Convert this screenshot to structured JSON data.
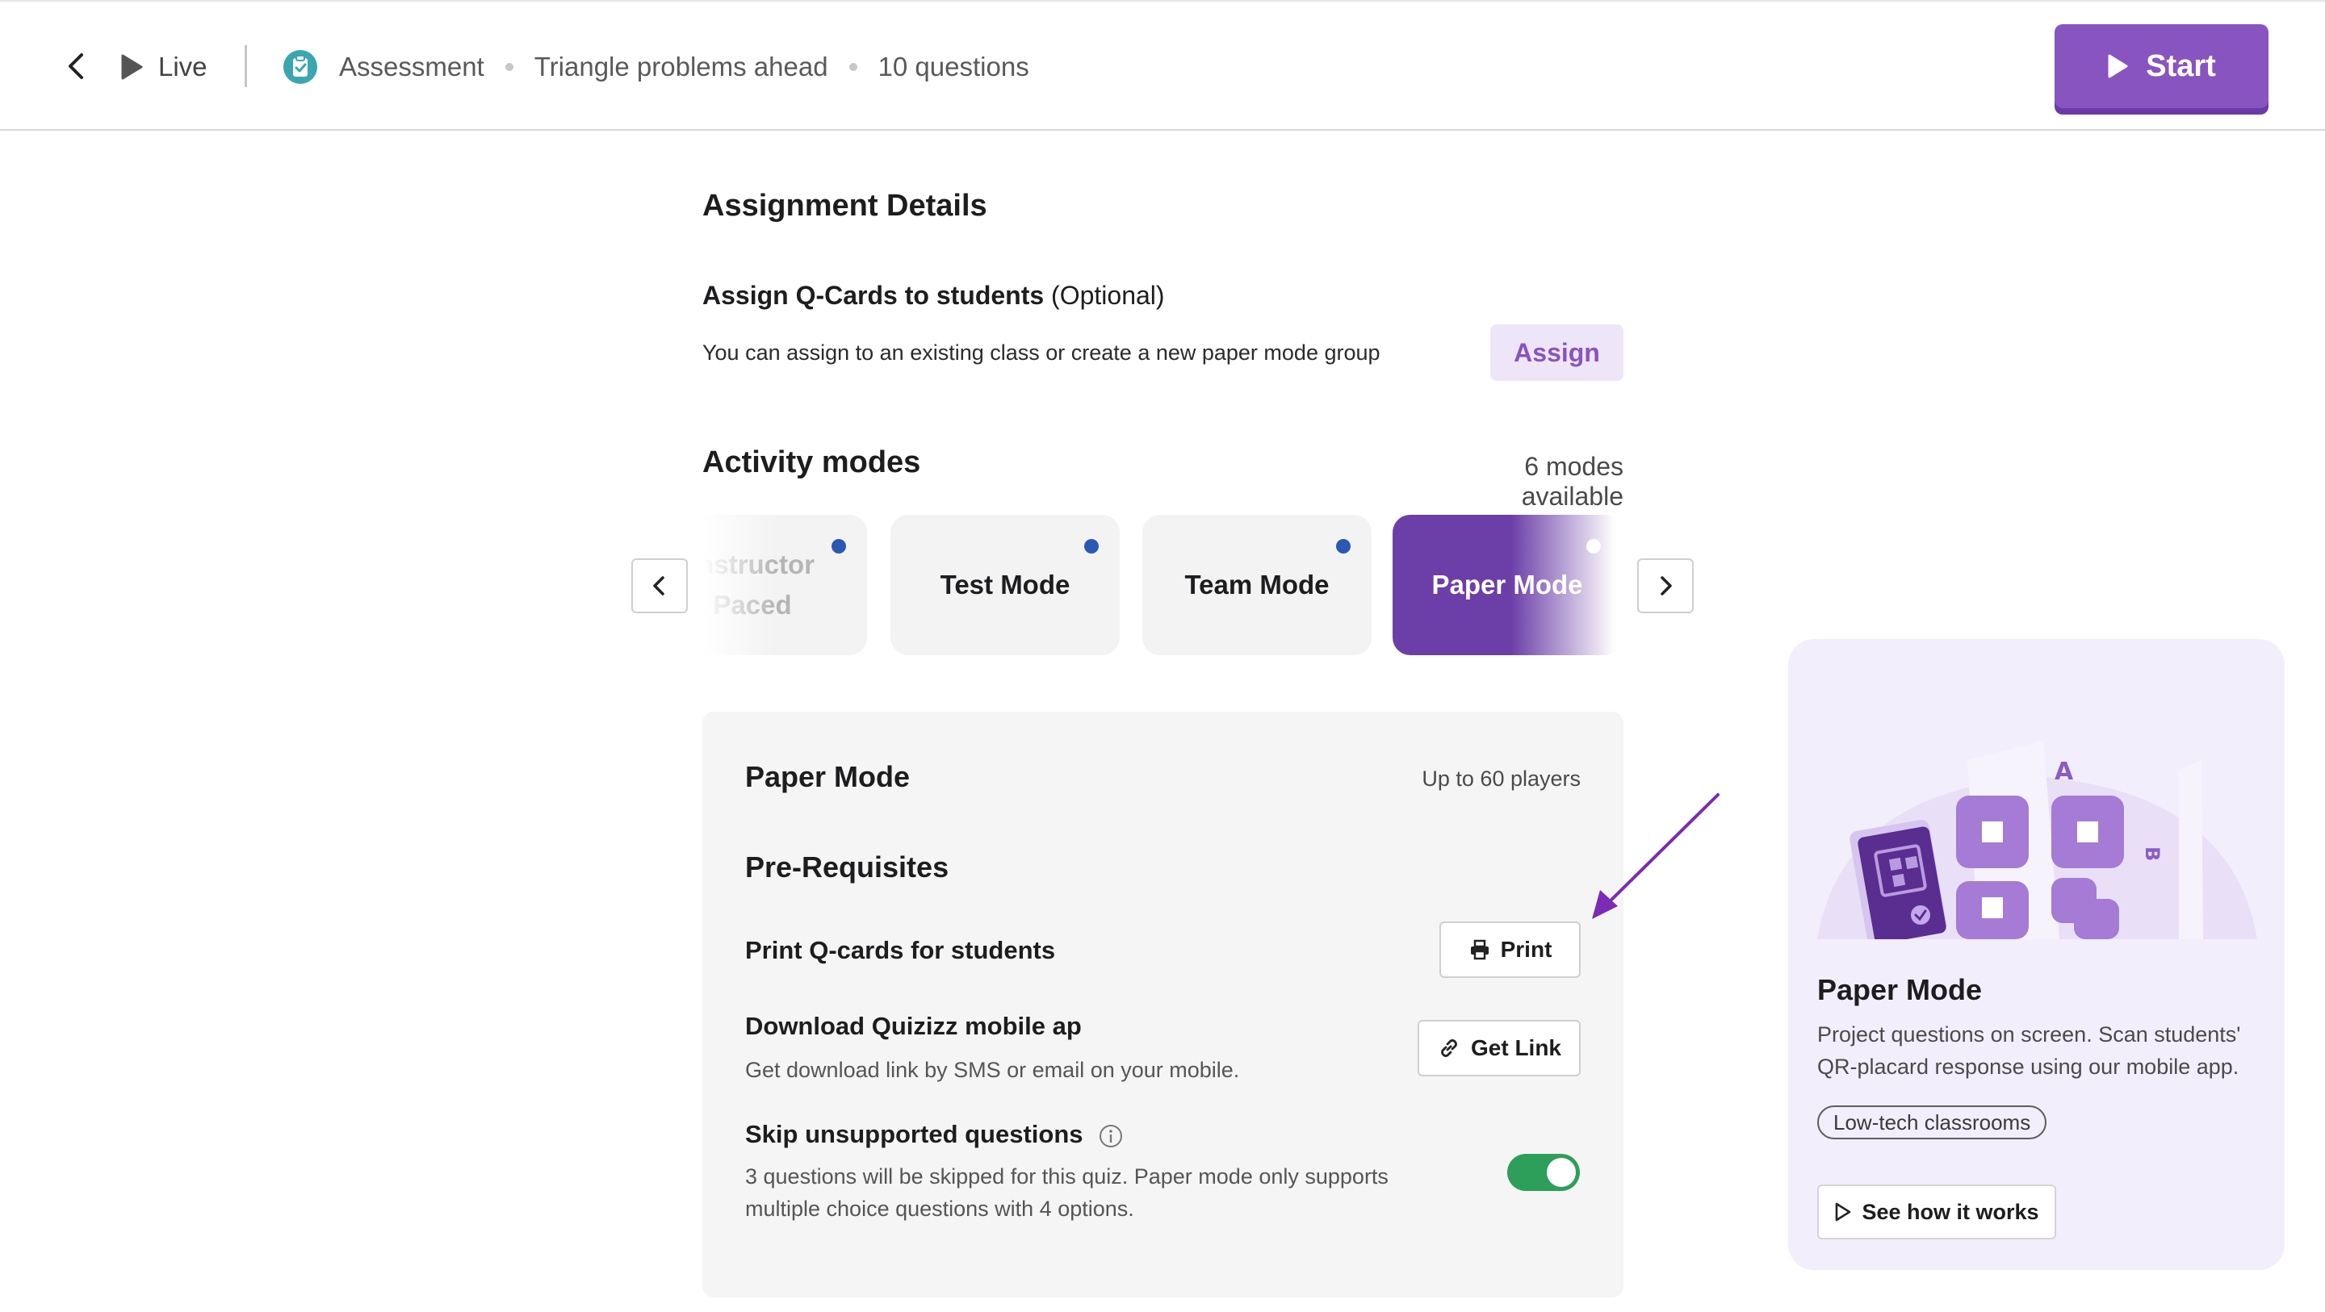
{
  "header": {
    "live_label": "Live",
    "breadcrumbs": [
      "Assessment",
      "Triangle problems ahead",
      "10 questions"
    ],
    "start_label": "Start"
  },
  "assignment": {
    "title": "Assignment Details",
    "qcards_title": "Assign Q-Cards to students",
    "qcards_optional": "(Optional)",
    "qcards_desc": "You can assign to an existing class or create a new paper mode group",
    "assign_label": "Assign"
  },
  "modes": {
    "title": "Activity modes",
    "count": "6 modes available",
    "items": [
      {
        "line1": "Instructor",
        "line2": "Paced"
      },
      {
        "label": "Test Mode"
      },
      {
        "label": "Team Mode"
      },
      {
        "label": "Paper Mode",
        "active": true
      }
    ]
  },
  "panel": {
    "title": "Paper Mode",
    "players": "Up to 60 players",
    "prereq_title": "Pre-Requisites",
    "print_row": "Print Q-cards for students",
    "print_label": "Print",
    "download_row": "Download Quizizz mobile ap",
    "download_desc": "Get download link by SMS or email on your mobile.",
    "getlink_label": "Get Link",
    "skip_row": "Skip unsupported questions",
    "skip_desc_1": "3 questions will be skipped for this quiz. Paper mode only supports",
    "skip_desc_2": "multiple choice questions with 4 options.",
    "skip_enabled": true
  },
  "info_card": {
    "title": "Paper Mode",
    "desc_1": "Project questions on screen. Scan students'",
    "desc_2": "QR-placard response using our mobile app.",
    "tag": "Low-tech classrooms",
    "see_label": "See how it works",
    "letters": [
      "A",
      "B"
    ]
  },
  "colors": {
    "brand_purple": "#8854c0",
    "active_mode": "#6b3ea8",
    "toggle_green": "#2e9e5b",
    "mode_dot": "#2a59b3",
    "card_bg": "#f3eefb"
  },
  "icons": [
    "chevron-left-icon",
    "play-icon",
    "assessment-icon",
    "printer-icon",
    "link-icon",
    "info-icon",
    "chevron-right-icon",
    "arrow-annotation-icon"
  ]
}
